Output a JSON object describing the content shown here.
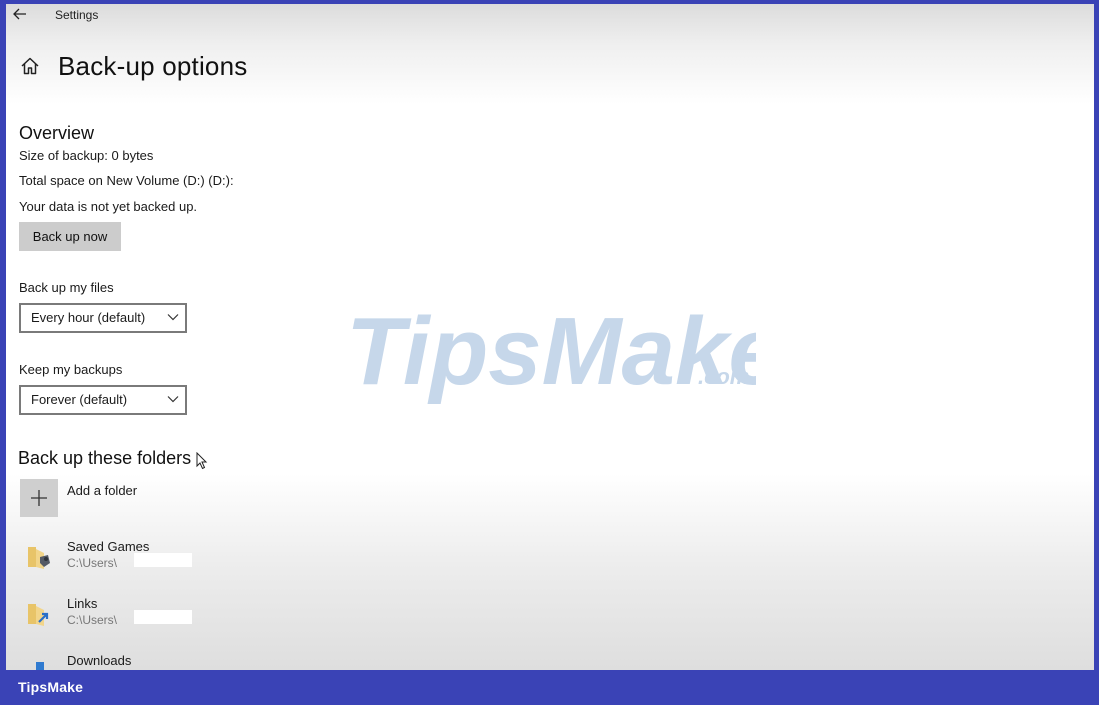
{
  "window": {
    "title": "Settings",
    "back_icon": "back-arrow-icon"
  },
  "page": {
    "title": "Back-up options",
    "home_icon": "home-icon"
  },
  "overview": {
    "heading": "Overview",
    "size_line": "Size of backup: 0 bytes",
    "space_line": "Total space on New Volume (D:) (D:):",
    "status_line": "Your data is not yet backed up.",
    "backup_button_label": "Back up now"
  },
  "backup_frequency": {
    "label": "Back up my files",
    "selected": "Every hour (default)"
  },
  "retention": {
    "label": "Keep my backups",
    "selected": "Forever (default)"
  },
  "folders": {
    "heading": "Back up these folders",
    "add_label": "Add a folder",
    "items": [
      {
        "name": "Saved Games",
        "path": "C:\\Users\\",
        "icon": "saved-games-folder-icon"
      },
      {
        "name": "Links",
        "path": "C:\\Users\\",
        "icon": "links-folder-icon"
      },
      {
        "name": "Downloads",
        "path": "",
        "icon": "downloads-folder-icon"
      }
    ]
  },
  "watermark": {
    "text": "TipsMake",
    "suffix": ".com"
  },
  "footer": {
    "brand": "TipsMake"
  },
  "colors": {
    "frame": "#3a43b6",
    "button_bg": "#cccccc",
    "watermark": "#c6d7ea"
  }
}
